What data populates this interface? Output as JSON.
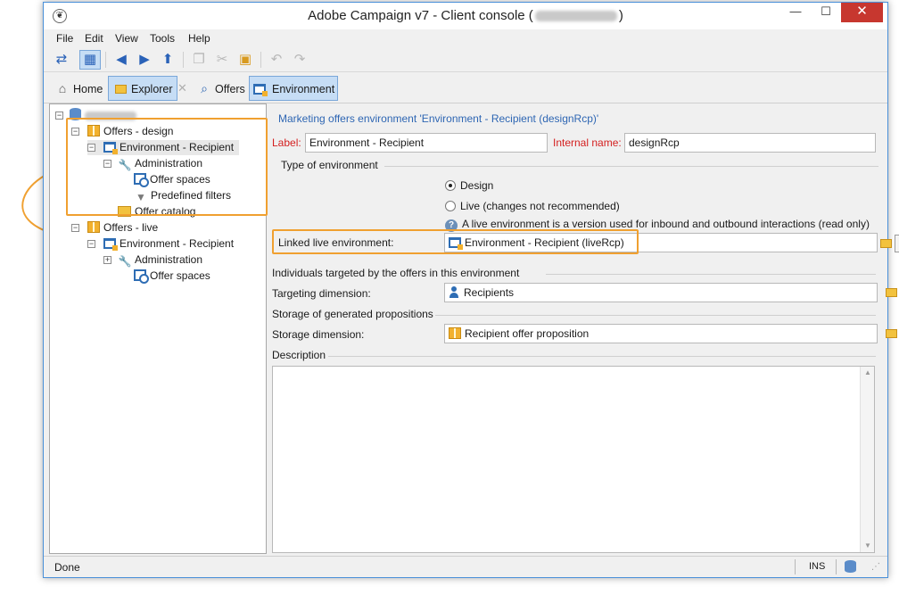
{
  "window": {
    "title_prefix": "Adobe Campaign v7 - Client console (",
    "title_suffix": ")",
    "app_icon": "adobe-campaign-logo",
    "controls": {
      "minimize": "—",
      "maximize": "☐",
      "close": "✕"
    }
  },
  "menu": [
    "File",
    "Edit",
    "View",
    "Tools",
    "Help"
  ],
  "toolbar_icons": [
    "login-icon",
    "explorer-toggle-icon",
    "back-icon",
    "forward-icon",
    "upload-icon",
    "copy-icon",
    "cut-icon",
    "paste-icon",
    "undo-icon",
    "redo-icon"
  ],
  "nav": {
    "home": "Home",
    "explorer": "Explorer",
    "offers": "Offers",
    "environment": "Environment"
  },
  "tree": {
    "root": "",
    "items": [
      {
        "label": "Offers - design"
      },
      {
        "label": "Environment - Recipient"
      },
      {
        "label": "Administration"
      },
      {
        "label": "Offer spaces"
      },
      {
        "label": "Predefined filters"
      },
      {
        "label": "Offer catalog"
      },
      {
        "label": "Offers - live"
      },
      {
        "label": "Environment - Recipient"
      },
      {
        "label": "Administration"
      },
      {
        "label": "Offer spaces"
      }
    ]
  },
  "form": {
    "title": "Marketing offers environment 'Environment - Recipient (designRcp)'",
    "label_caption": "Label:",
    "label_value": "Environment - Recipient",
    "internal_caption": "Internal name:",
    "internal_value": "designRcp",
    "env_type_section": "Type of environment",
    "radio_design": "Design",
    "radio_live": "Live (changes not recommended)",
    "info_text": "A live environment is a version used for inbound and outbound interactions (read only)",
    "linked_caption": "Linked live environment:",
    "linked_value": "Environment - Recipient (liveRcp)",
    "individuals_section": "Individuals targeted by the offers in this environment",
    "targeting_caption": "Targeting dimension:",
    "targeting_value": "Recipients",
    "storage_section": "Storage of generated propositions",
    "storage_caption": "Storage dimension:",
    "storage_value": "Recipient offer proposition",
    "description_section": "Description",
    "description_value": ""
  },
  "status": {
    "text": "Done",
    "mode": "INS"
  },
  "colors": {
    "highlight": "#f0a030",
    "accent_blue": "#2e66b3",
    "required_red": "#d42020",
    "close_red": "#c7372f"
  }
}
